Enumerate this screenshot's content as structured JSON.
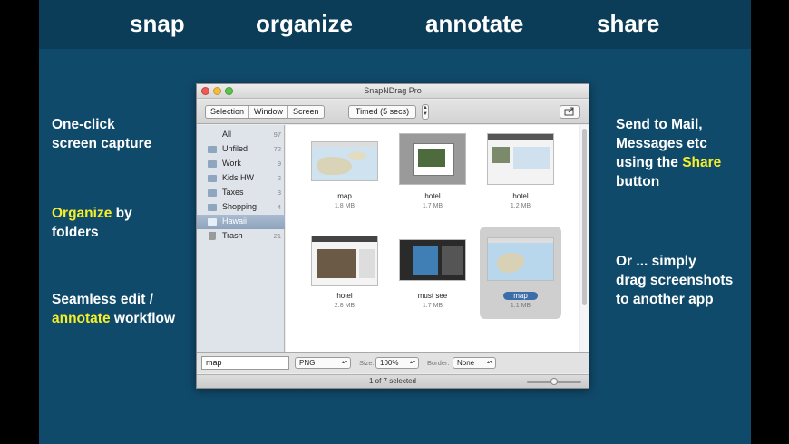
{
  "banner": {
    "words": [
      "snap",
      "organize",
      "annotate",
      "share"
    ]
  },
  "captions": {
    "capture": [
      "One-click",
      "screen capture"
    ],
    "organize": {
      "highlight": "Organize",
      "rest": " by",
      "line2": "folders"
    },
    "annotate": {
      "line1": "Seamless edit /",
      "highlight": "annotate",
      "rest": " workflow"
    },
    "share": {
      "line1": "Send to Mail,",
      "line2": "Messages etc",
      "line3_pre": "using the ",
      "highlight": "Share",
      "line4": "button"
    },
    "drag": [
      "Or ... simply",
      "drag screenshots",
      "to another app"
    ]
  },
  "colors": {
    "highlight": "#f5ef2a",
    "background": "#104a6b",
    "banner": "#0b3c58"
  },
  "window": {
    "title": "SnapNDrag Pro",
    "toolbar": {
      "capture_modes": [
        "Selection",
        "Window",
        "Screen"
      ],
      "timed_label": "Timed (5 secs)",
      "stepper_icon": "up-down-stepper",
      "share_icon": "share-icon"
    },
    "sidebar": [
      {
        "label": "All",
        "count": "97",
        "icon": ""
      },
      {
        "label": "Unfiled",
        "count": "72",
        "icon": "folder-icon"
      },
      {
        "label": "Work",
        "count": "9",
        "icon": "folder-icon"
      },
      {
        "label": "Kids HW",
        "count": "2",
        "icon": "folder-icon"
      },
      {
        "label": "Taxes",
        "count": "3",
        "icon": "folder-icon"
      },
      {
        "label": "Shopping",
        "count": "4",
        "icon": "folder-icon"
      },
      {
        "label": "Hawaii",
        "count": "",
        "icon": "folder-icon",
        "selected": true
      },
      {
        "label": "Trash",
        "count": "21",
        "icon": "trash-icon"
      }
    ],
    "items": [
      {
        "name": "map",
        "size": "1.8 MB"
      },
      {
        "name": "hotel",
        "size": "1.7 MB"
      },
      {
        "name": "hotel",
        "size": "1.2 MB"
      },
      {
        "name": "hotel",
        "size": "2.8 MB"
      },
      {
        "name": "must see",
        "size": "1.7 MB"
      },
      {
        "name": "map",
        "size": "1.1 MB",
        "selected": true
      }
    ],
    "bottom": {
      "filename": "map",
      "format": "PNG",
      "size_label": "Size:",
      "size_value": "100%",
      "border_label": "Border:",
      "border_value": "None"
    },
    "status": "1 of 7 selected"
  }
}
